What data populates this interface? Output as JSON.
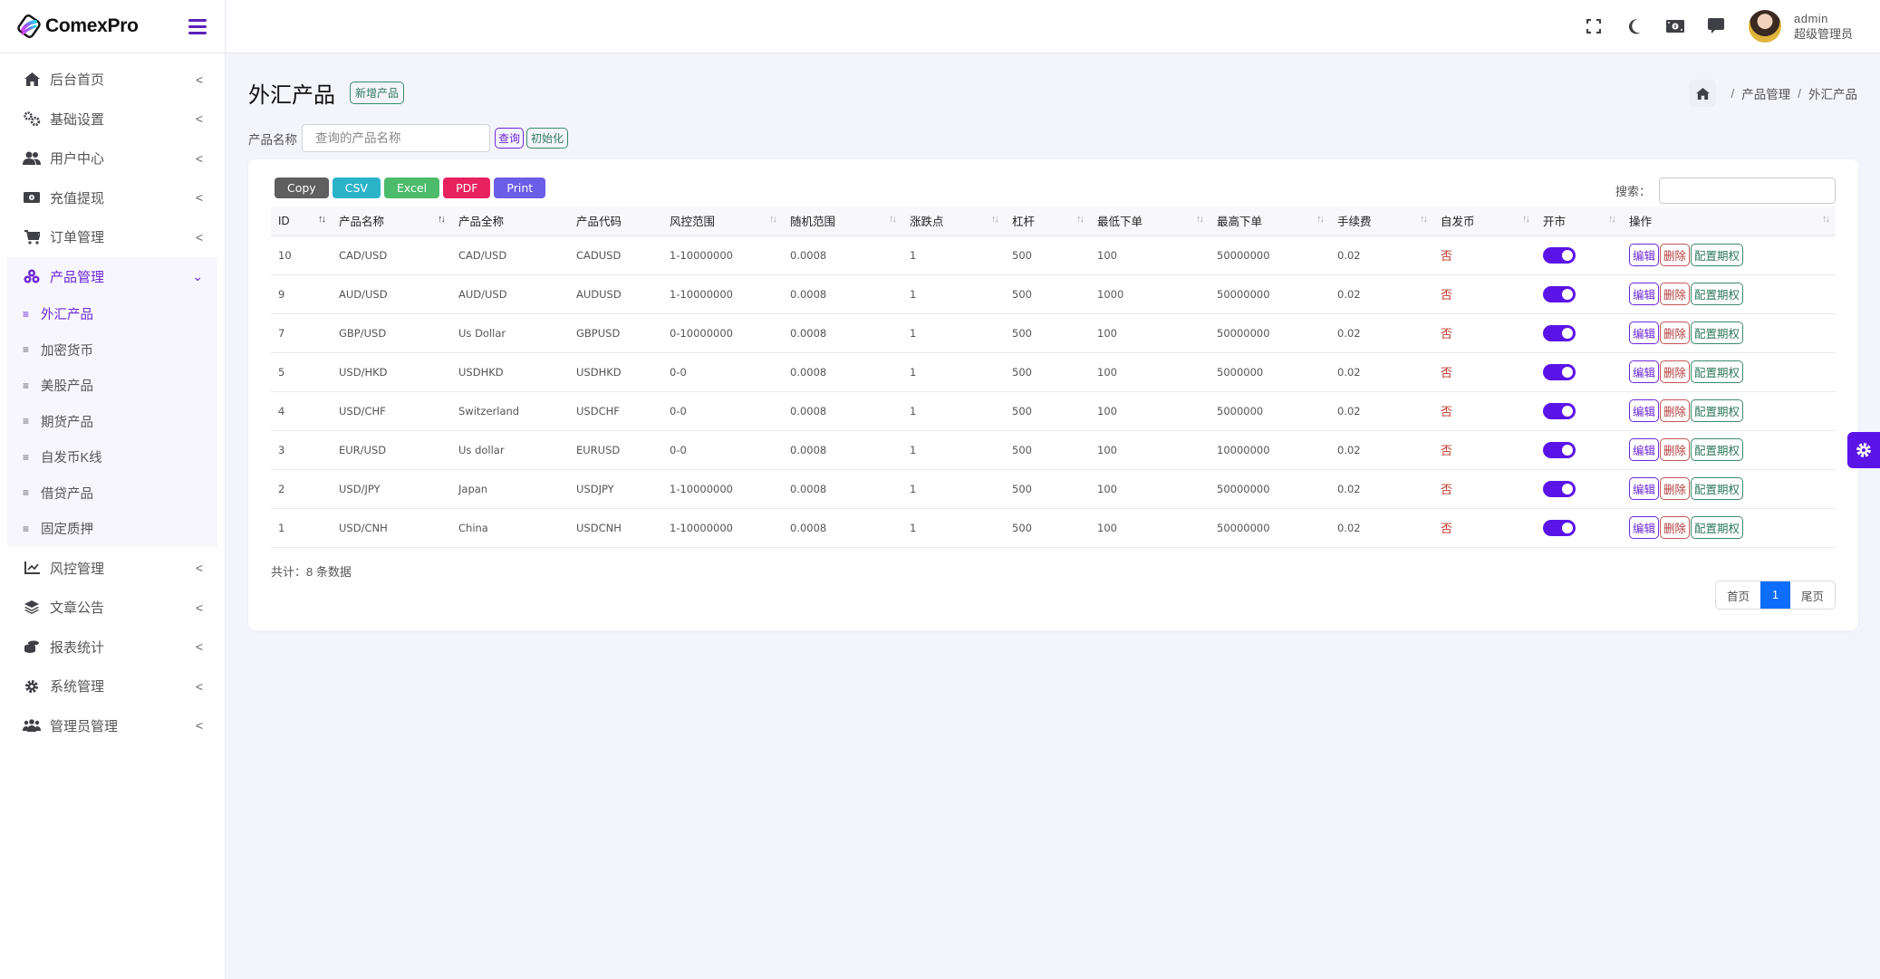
{
  "app": {
    "logo_text": "ComexPro"
  },
  "sidebar": {
    "items": [
      {
        "label": "后台首页",
        "icon": "home-icon"
      },
      {
        "label": "基础设置",
        "icon": "cogs-icon"
      },
      {
        "label": "用户中心",
        "icon": "users-icon"
      },
      {
        "label": "充值提现",
        "icon": "money-icon"
      },
      {
        "label": "订单管理",
        "icon": "cart-icon"
      },
      {
        "label": "产品管理",
        "icon": "cubes-icon"
      },
      {
        "label": "风控管理",
        "icon": "chart-line-icon"
      },
      {
        "label": "文章公告",
        "icon": "layers-icon"
      },
      {
        "label": "报表统计",
        "icon": "coins-icon"
      },
      {
        "label": "系统管理",
        "icon": "gear-icon"
      },
      {
        "label": "管理员管理",
        "icon": "user-group-icon"
      }
    ],
    "submenu": [
      {
        "label": "外汇产品",
        "active": true
      },
      {
        "label": "加密货币"
      },
      {
        "label": "美股产品"
      },
      {
        "label": "期货产品"
      },
      {
        "label": "自发币K线"
      },
      {
        "label": "借贷产品"
      },
      {
        "label": "固定质押"
      }
    ]
  },
  "topbar": {
    "icons": [
      "fullscreen-icon",
      "moon-icon",
      "money-icon",
      "comment-icon"
    ],
    "user": {
      "name": "admin",
      "role": "超级管理员"
    }
  },
  "page": {
    "title": "外汇产品",
    "add_button": "新增产品",
    "breadcrumb": [
      "产品管理",
      "外汇产品"
    ]
  },
  "filter": {
    "label": "产品名称",
    "placeholder": "查询的产品名称",
    "value": "",
    "query_button": "查询",
    "reset_button": "初始化"
  },
  "export_buttons": [
    {
      "label": "Copy",
      "color": "#5f5f5f"
    },
    {
      "label": "CSV",
      "color": "#2bb3c9"
    },
    {
      "label": "Excel",
      "color": "#4cbb6c"
    },
    {
      "label": "PDF",
      "color": "#e8215f"
    },
    {
      "label": "Print",
      "color": "#6a5de8"
    }
  ],
  "search": {
    "label": "搜索：",
    "value": ""
  },
  "table": {
    "columns": [
      "ID",
      "产品名称",
      "产品全称",
      "产品代码",
      "风控范围",
      "随机范围",
      "涨跌点",
      "杠杆",
      "最低下单",
      "最高下单",
      "手续费",
      "自发币",
      "开市",
      "操作"
    ],
    "rows": [
      {
        "id": "10",
        "name": "CAD/USD",
        "full_name": "CAD/USD",
        "code": "CADUSD",
        "risk_range": "1-10000000",
        "random_range": "0.0008",
        "pips": "1",
        "leverage": "500",
        "min_order": "100",
        "max_order": "50000000",
        "fee": "0.02",
        "self_coin": "否",
        "open": true
      },
      {
        "id": "9",
        "name": "AUD/USD",
        "full_name": "AUD/USD",
        "code": "AUDUSD",
        "risk_range": "1-10000000",
        "random_range": "0.0008",
        "pips": "1",
        "leverage": "500",
        "min_order": "1000",
        "max_order": "50000000",
        "fee": "0.02",
        "self_coin": "否",
        "open": true
      },
      {
        "id": "7",
        "name": "GBP/USD",
        "full_name": "Us Dollar",
        "code": "GBPUSD",
        "risk_range": "0-10000000",
        "random_range": "0.0008",
        "pips": "1",
        "leverage": "500",
        "min_order": "100",
        "max_order": "50000000",
        "fee": "0.02",
        "self_coin": "否",
        "open": true
      },
      {
        "id": "5",
        "name": "USD/HKD",
        "full_name": "USDHKD",
        "code": "USDHKD",
        "risk_range": "0-0",
        "random_range": "0.0008",
        "pips": "1",
        "leverage": "500",
        "min_order": "100",
        "max_order": "5000000",
        "fee": "0.02",
        "self_coin": "否",
        "open": true
      },
      {
        "id": "4",
        "name": "USD/CHF",
        "full_name": "Switzerland",
        "code": "USDCHF",
        "risk_range": "0-0",
        "random_range": "0.0008",
        "pips": "1",
        "leverage": "500",
        "min_order": "100",
        "max_order": "5000000",
        "fee": "0.02",
        "self_coin": "否",
        "open": true
      },
      {
        "id": "3",
        "name": "EUR/USD",
        "full_name": "Us dollar",
        "code": "EURUSD",
        "risk_range": "0-0",
        "random_range": "0.0008",
        "pips": "1",
        "leverage": "500",
        "min_order": "100",
        "max_order": "10000000",
        "fee": "0.02",
        "self_coin": "否",
        "open": true
      },
      {
        "id": "2",
        "name": "USD/JPY",
        "full_name": "Japan",
        "code": "USDJPY",
        "risk_range": "1-10000000",
        "random_range": "0.0008",
        "pips": "1",
        "leverage": "500",
        "min_order": "100",
        "max_order": "50000000",
        "fee": "0.02",
        "self_coin": "否",
        "open": true
      },
      {
        "id": "1",
        "name": "USD/CNH",
        "full_name": "China",
        "code": "USDCNH",
        "risk_range": "1-10000000",
        "random_range": "0.0008",
        "pips": "1",
        "leverage": "500",
        "min_order": "100",
        "max_order": "50000000",
        "fee": "0.02",
        "self_coin": "否",
        "open": true
      }
    ],
    "actions": {
      "edit": "编辑",
      "delete": "删除",
      "options": "配置期权"
    }
  },
  "footer": {
    "total": "共计：8 条数据",
    "pager": {
      "first": "首页",
      "current": "1",
      "last": "尾页"
    }
  }
}
